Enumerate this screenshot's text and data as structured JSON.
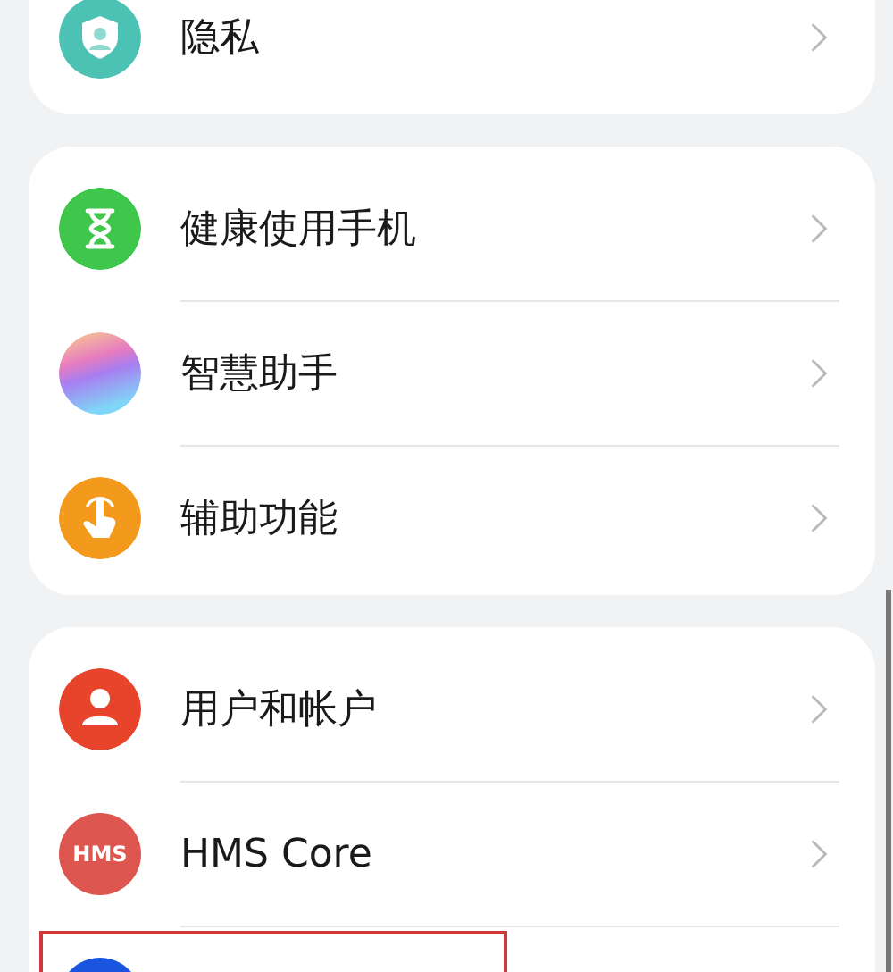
{
  "groups": [
    {
      "items": [
        {
          "kind": "privacy",
          "label": "隐私"
        }
      ]
    },
    {
      "items": [
        {
          "kind": "hourglass",
          "label": "健康使用手机"
        },
        {
          "kind": "assistant",
          "label": "智慧助手"
        },
        {
          "kind": "accessibility",
          "label": "辅助功能"
        }
      ]
    },
    {
      "items": [
        {
          "kind": "user",
          "label": "用户和帐户"
        },
        {
          "kind": "hms",
          "icon_text": "HMS",
          "label": "HMS Core"
        },
        {
          "kind": "blue",
          "highlighted": true
        }
      ]
    }
  ]
}
